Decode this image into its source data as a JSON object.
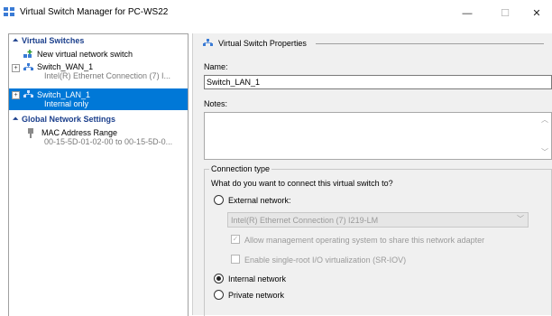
{
  "window": {
    "title": "Virtual Switch Manager for PC-WS22",
    "minimize": "—",
    "maximize": "☐",
    "close": "✕"
  },
  "sidebar": {
    "virtual_switches_header": "Virtual Switches",
    "new_switch": "New virtual network switch",
    "switches": [
      {
        "name": "Switch_WAN_1",
        "detail": "Intel(R) Ethernet Connection (7) I..."
      },
      {
        "name": "Switch_LAN_1",
        "detail": "Internal only"
      }
    ],
    "global_header": "Global Network Settings",
    "mac_range": {
      "name": "MAC Address Range",
      "detail": "00-15-5D-01-02-00 to 00-15-5D-0..."
    }
  },
  "properties": {
    "header": "Virtual Switch Properties",
    "name_label": "Name:",
    "name_value": "Switch_LAN_1",
    "notes_label": "Notes:",
    "notes_value": "",
    "connection_type_label": "Connection type",
    "question": "What do you want to connect this virtual switch to?",
    "external_label": "External network:",
    "adapter_value": "Intel(R) Ethernet Connection (7) I219-LM",
    "allow_mgmt_label": "Allow management operating system to share this network adapter",
    "sriov_label": "Enable single-root I/O virtualization (SR-IOV)",
    "internal_label": "Internal network",
    "private_label": "Private network",
    "selected_type": "Internal network"
  },
  "colors": {
    "selection": "#0078d7",
    "section_header": "#1b3f8c"
  }
}
